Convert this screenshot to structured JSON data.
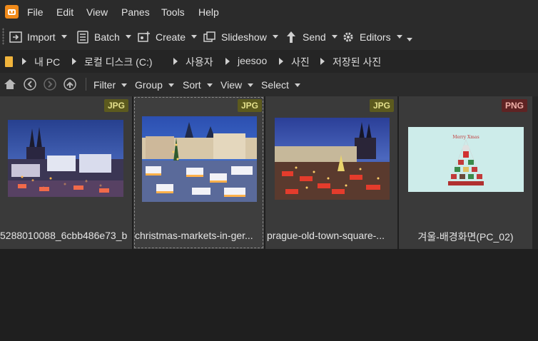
{
  "menu": {
    "items": [
      {
        "label": "File"
      },
      {
        "label": "Edit"
      },
      {
        "label": "View"
      },
      {
        "label": "Panes"
      },
      {
        "label": "Tools"
      },
      {
        "label": "Help"
      }
    ]
  },
  "toolbar": {
    "import_label": "Import",
    "batch_label": "Batch",
    "create_label": "Create",
    "slideshow_label": "Slideshow",
    "send_label": "Send",
    "editors_label": "Editors"
  },
  "address": {
    "crumbs": [
      "내 PC",
      "로컬 디스크 (C:)",
      "사용자",
      "jeesoo",
      "사진",
      "저장된 사진"
    ]
  },
  "filters": {
    "filter_label": "Filter",
    "group_label": "Group",
    "sort_label": "Sort",
    "view_label": "View",
    "select_label": "Select"
  },
  "files": [
    {
      "badge": "JPG",
      "caption": "5288010088_6cbb486e73_b"
    },
    {
      "badge": "JPG",
      "caption": "christmas-markets-in-ger..."
    },
    {
      "badge": "JPG",
      "caption": "prague-old-town-square-..."
    },
    {
      "badge": "PNG",
      "caption": "겨울-배경화면(PC_02)"
    }
  ],
  "colors": {
    "app_accent": "#f08a1a",
    "jpg_badge": "#5c5a1e",
    "png_badge": "#5e2323",
    "folder": "#f0b43c"
  }
}
